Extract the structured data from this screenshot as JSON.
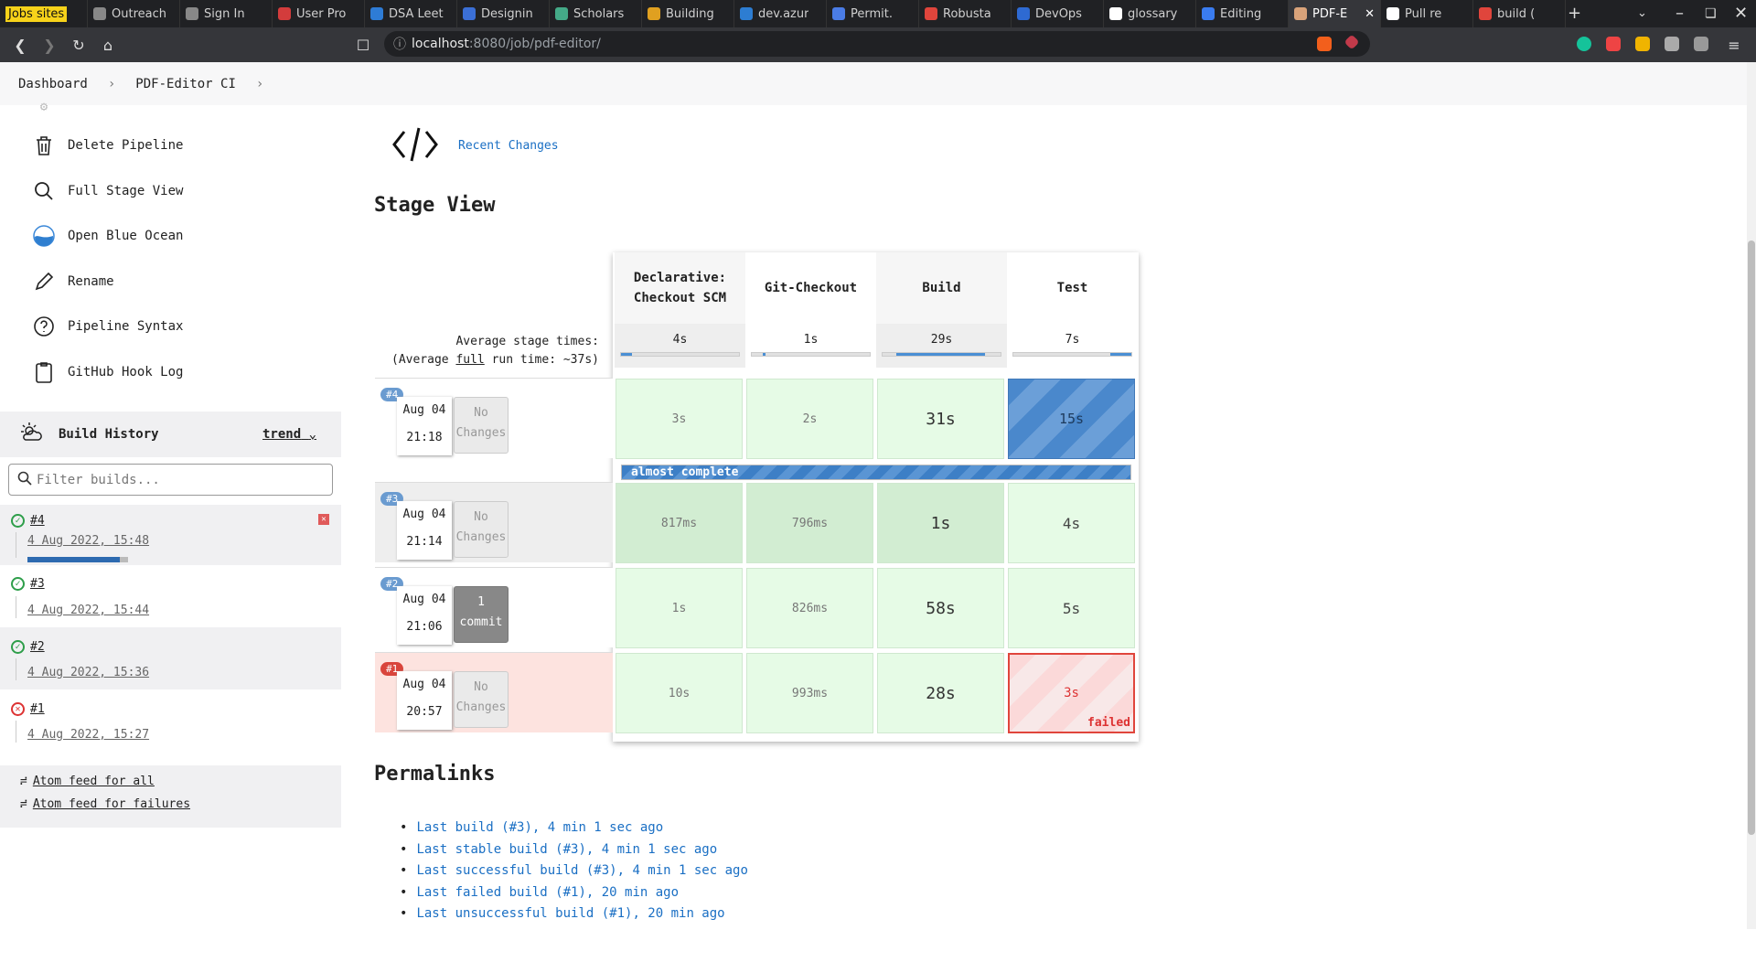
{
  "browser": {
    "tabs": [
      {
        "label": "Jobs sites",
        "icon": "bookmark-icon",
        "color": "#f7d21a"
      },
      {
        "label": "Outreach",
        "icon": "globe-icon",
        "color": "#888888"
      },
      {
        "label": "Sign In",
        "icon": "globe-icon",
        "color": "#888888"
      },
      {
        "label": "User Pro",
        "icon": "app-icon",
        "color": "#d33c3c"
      },
      {
        "label": "DSA Leet",
        "icon": "check-icon",
        "color": "#2e7cd6"
      },
      {
        "label": "Designin",
        "icon": "app-icon",
        "color": "#3b6fd6"
      },
      {
        "label": "Scholars",
        "icon": "app-icon",
        "color": "#4a8"
      },
      {
        "label": "Building",
        "icon": "app-icon",
        "color": "#e0a020"
      },
      {
        "label": "dev.azur",
        "icon": "app-icon",
        "color": "#2d7dd2"
      },
      {
        "label": "Permit.",
        "icon": "app-icon",
        "color": "#4a7ce6"
      },
      {
        "label": "Robusta",
        "icon": "app-icon",
        "color": "#e0453c"
      },
      {
        "label": "DevOps",
        "icon": "app-icon",
        "color": "#2e6ad2"
      },
      {
        "label": "glossary",
        "icon": "github-icon",
        "color": "#ffffff"
      },
      {
        "label": "Editing",
        "icon": "app-icon",
        "color": "#3a7cf0"
      },
      {
        "label": "PDF-E",
        "icon": "jenkins-icon",
        "color": "#d9a37a"
      },
      {
        "label": "Pull re",
        "icon": "github-icon",
        "color": "#ffffff"
      },
      {
        "label": "build (",
        "icon": "app-icon",
        "color": "#e0453c"
      }
    ],
    "url_host": "localhost",
    "url_port": ":8080",
    "url_path": "/job/pdf-editor/"
  },
  "breadcrumb": {
    "items": [
      "Dashboard",
      "PDF-Editor CI"
    ]
  },
  "sidebar": {
    "tasks": [
      "Delete Pipeline",
      "Full Stage View",
      "Open Blue Ocean",
      "Rename",
      "Pipeline Syntax",
      "GitHub Hook Log"
    ],
    "build_history_title": "Build History",
    "trend_label": "trend",
    "filter_placeholder": "Filter builds...",
    "builds": [
      {
        "num": "#4",
        "date": "4 Aug 2022, 15:48",
        "status": "running"
      },
      {
        "num": "#3",
        "date": "4 Aug 2022, 15:44",
        "status": "success"
      },
      {
        "num": "#2",
        "date": "4 Aug 2022, 15:36",
        "status": "success"
      },
      {
        "num": "#1",
        "date": "4 Aug 2022, 15:27",
        "status": "failed"
      }
    ],
    "feeds": [
      "Atom feed for all",
      "Atom feed for failures"
    ]
  },
  "main": {
    "recent_changes": "Recent Changes",
    "stage_view_title": "Stage View",
    "avg_label_1": "Average stage times:",
    "avg_label_2a": "(Average ",
    "avg_label_full": "full",
    "avg_label_2b": " run time: ~37s)",
    "stages": [
      "Declarative: Checkout SCM",
      "Git-Checkout",
      "Build",
      "Test"
    ],
    "avg_times": [
      "4s",
      "1s",
      "29s",
      "7s"
    ],
    "runs": [
      {
        "badge": "#4",
        "date": "Aug 04",
        "time": "21:18",
        "changes": "No Changes",
        "cells": [
          "3s",
          "2s",
          "31s",
          "15s"
        ]
      },
      {
        "badge": "#3",
        "date": "Aug 04",
        "time": "21:14",
        "changes": "No Changes",
        "cells": [
          "817ms",
          "796ms",
          "1s",
          "4s"
        ]
      },
      {
        "badge": "#2",
        "date": "Aug 04",
        "time": "21:06",
        "changes": "1 commit",
        "cells": [
          "1s",
          "826ms",
          "58s",
          "5s"
        ]
      },
      {
        "badge": "#1",
        "date": "Aug 04",
        "time": "20:57",
        "changes": "No Changes",
        "cells": [
          "10s",
          "993ms",
          "28s",
          "3s"
        ]
      }
    ],
    "progress_label": "almost complete",
    "failed_label": "failed",
    "permalinks_title": "Permalinks",
    "permalinks": [
      "Last build (#3), 4 min 1 sec ago",
      "Last stable build (#3), 4 min 1 sec ago",
      "Last successful build (#3), 4 min 1 sec ago",
      "Last failed build (#1), 20 min ago",
      "Last unsuccessful build (#1), 20 min ago"
    ]
  }
}
